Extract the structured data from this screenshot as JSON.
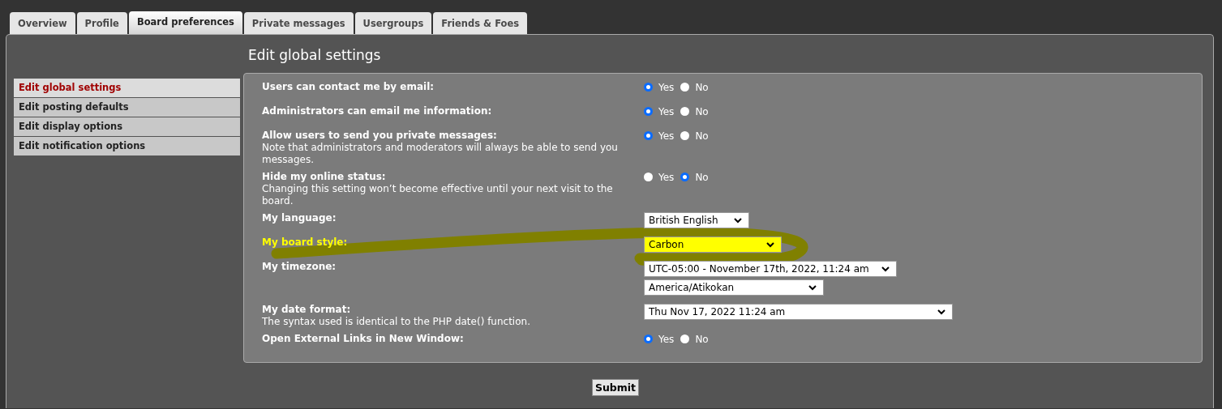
{
  "tabs": [
    {
      "label": "Overview",
      "selected": false
    },
    {
      "label": "Profile",
      "selected": false
    },
    {
      "label": "Board preferences",
      "selected": true
    },
    {
      "label": "Private messages",
      "selected": false
    },
    {
      "label": "Usergroups",
      "selected": false
    },
    {
      "label": "Friends & Foes",
      "selected": false
    }
  ],
  "title": "Edit global settings",
  "sidebar": {
    "items": [
      {
        "label": "Edit global settings",
        "selected": true
      },
      {
        "label": "Edit posting defaults",
        "selected": false
      },
      {
        "label": "Edit display options",
        "selected": false
      },
      {
        "label": "Edit notification options",
        "selected": false
      }
    ]
  },
  "settings": [
    {
      "label": "Users can contact me by email:",
      "highlighted": false,
      "kind": "radio",
      "options": [
        {
          "label": "Yes",
          "selected": true
        },
        {
          "label": "No",
          "selected": false
        }
      ]
    },
    {
      "label": "Administrators can email me information:",
      "highlighted": false,
      "kind": "radio",
      "options": [
        {
          "label": "Yes",
          "selected": true
        },
        {
          "label": "No",
          "selected": false
        }
      ]
    },
    {
      "label": "Allow users to send you private messages:",
      "explain": "Note that administrators and moderators will always be able to send you messages.",
      "highlighted": false,
      "kind": "radio",
      "options": [
        {
          "label": "Yes",
          "selected": true
        },
        {
          "label": "No",
          "selected": false
        }
      ]
    },
    {
      "label": "Hide my online status:",
      "explain": "Changing this setting won’t become effective until your next visit to the board.",
      "highlighted": false,
      "kind": "radio",
      "options": [
        {
          "label": "Yes",
          "selected": false
        },
        {
          "label": "No",
          "selected": true
        }
      ]
    },
    {
      "label": "My language:",
      "highlighted": false,
      "kind": "select",
      "selects": [
        "British English"
      ]
    },
    {
      "label": "My board style:",
      "highlighted": true,
      "kind": "select",
      "selects": [
        "Carbon"
      ]
    },
    {
      "label": "My timezone:",
      "highlighted": false,
      "kind": "select",
      "selects": [
        "UTC-05:00 - November 17th, 2022, 11:24 am",
        "America/Atikokan"
      ]
    },
    {
      "label": "My date format:",
      "explain": "The syntax used is identical to the PHP date() function.",
      "highlighted": false,
      "kind": "select",
      "selects": [
        "Thu Nov 17, 2022 11:24 am"
      ]
    },
    {
      "label": "Open External Links in New Window:",
      "highlighted": false,
      "kind": "radio",
      "options": [
        {
          "label": "Yes",
          "selected": true
        },
        {
          "label": "No",
          "selected": false
        }
      ]
    }
  ],
  "submit": "Submit"
}
